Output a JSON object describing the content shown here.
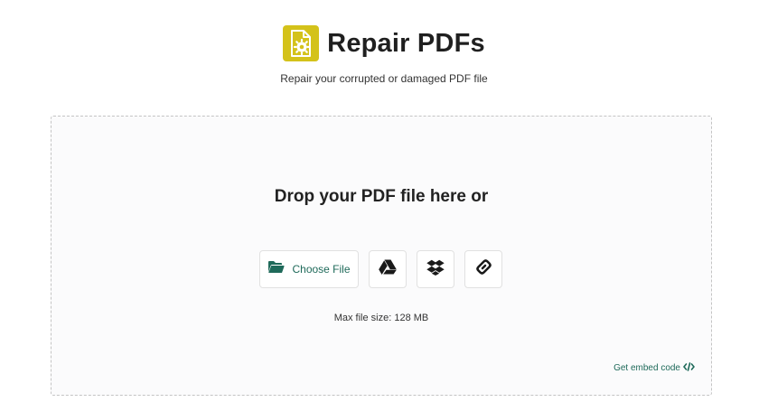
{
  "header": {
    "title": "Repair PDFs",
    "subtitle": "Repair your corrupted or damaged PDF file",
    "logo_icon": "pdf-gear-icon",
    "logo_color": "#d4c21a"
  },
  "dropzone": {
    "heading": "Drop your PDF file here or",
    "choose_file_label": "Choose File",
    "choose_file_icon": "folder-open-icon",
    "sources": [
      {
        "name": "google-drive",
        "icon": "google-drive-icon"
      },
      {
        "name": "dropbox",
        "icon": "dropbox-icon"
      },
      {
        "name": "url-link",
        "icon": "link-icon"
      }
    ],
    "max_file_size": "Max file size: 128 MB",
    "embed_label": "Get embed code",
    "embed_icon": "code-icon",
    "accent_color": "#1f6a5a"
  }
}
